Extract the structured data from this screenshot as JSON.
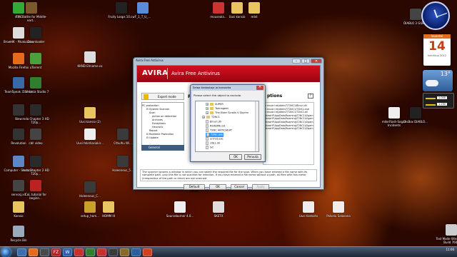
{
  "desktop_icons": [
    {
      "label": "mIRC",
      "color": "#33aa33"
    },
    {
      "label": "The Battle for Middle-eart...",
      "color": "#7a5a2a"
    },
    {
      "label": "Fruity Loops 10.cw",
      "color": "#222"
    },
    {
      "label": "F_1_T_U_...",
      "color": "#5b8bd8"
    },
    {
      "label": "mouseala...",
      "color": "#c33"
    },
    {
      "label": "Uusi kansio",
      "color": "#e8c560"
    },
    {
      "label": "mikt",
      "color": "#e8c560"
    },
    {
      "label": "DIABLO 3 GUEST",
      "color": "#444"
    },
    {
      "label": "BrowHK - Pikakuvake",
      "color": "#ddd"
    },
    {
      "label": "iDownloader",
      "color": "#222"
    },
    {
      "label": "Mozilla Firefox",
      "color": "#e66a1c"
    },
    {
      "label": "uTorrent",
      "color": "#4aa03c"
    },
    {
      "label": "KKND Ehnome.co",
      "color": "#ddd"
    },
    {
      "label": "TeamSpeak 3 Client",
      "color": "#3a69a8"
    },
    {
      "label": "Camtasia Studio 7",
      "color": "#2f7f2f"
    },
    {
      "label": "Biew",
      "color": "#333"
    },
    {
      "label": "mda Chapter 3 HD 720p...",
      "color": "#2a2a2a"
    },
    {
      "label": "Uusi kansio (2)",
      "color": "#e8c560"
    },
    {
      "label": "Revolution",
      "color": "#333"
    },
    {
      "label": "cbll video",
      "color": "#444"
    },
    {
      "label": "Uusi tekstiasiakir...",
      "color": "#eee"
    },
    {
      "label": "Cthulhu Wi...",
      "color": "#3a3a3a"
    },
    {
      "label": "Computer - Shortcut",
      "color": "#5c86c4"
    },
    {
      "label": "mda Chapter 2 HD 720p...",
      "color": "#2a2a2a"
    },
    {
      "label": "Haleeneus_5...",
      "color": "#3a3a3a"
    },
    {
      "label": "servosj.xit",
      "color": "#444"
    },
    {
      "label": "CoL tutorial for beginn...",
      "color": "#b22"
    },
    {
      "label": "Kansio",
      "color": "#e8c560"
    },
    {
      "label": "Haleeneus_C...",
      "color": "#3a3a3a"
    },
    {
      "label": "setup_hom...",
      "color": "#c8a02a"
    },
    {
      "label": "HOMM III",
      "color": "#e8c560"
    },
    {
      "label": "Sourceburner 4.0...",
      "color": "#eee"
    },
    {
      "label": "SKETX",
      "color": "#ddd"
    },
    {
      "label": "Uusi tiedosto",
      "color": "#eee"
    },
    {
      "label": "Palvelu Salasana",
      "color": "#eee"
    },
    {
      "label": "mikeFlash-Sogan Incidents",
      "color": "#eee"
    },
    {
      "label": "DisBox DIABLO...",
      "color": "#222"
    },
    {
      "label": "Recycle Bin",
      "color": "#9ab"
    },
    {
      "label": "Test Mode Windows 7 Build 7601",
      "color": "#ccc"
    }
  ],
  "gadgets": {
    "calendar_weekday": "lauantai",
    "calendar_day": "14",
    "calendar_month": "heinäkuu 2012",
    "weather_temp": "13°",
    "cpu_values": [
      "1.000",
      "1.250"
    ]
  },
  "avira": {
    "window_title": "Avira Free Antivirus",
    "brand": "AVIRA",
    "product": "Avira Free Antivirus",
    "expert_mode": "Expert mode",
    "left_heading": "PC",
    "tree": [
      "PC protection",
      "System Scanner",
      "Scan",
      "Action on detection",
      "Archives",
      "Exceptions",
      "Heuristic",
      "Report",
      "Realtime Protection",
      "Update",
      "General"
    ],
    "right_heading": "ptions",
    "files": [
      "e mustri etyöteksT\\T2NC1\\Binurl.dll",
      "e mustri etyöteksT\\T2NC1\\T2NC1.exe",
      "e mustri etyöteksT\\T2NC1\\T2NC1.dll",
      "BrowHF\\AppData\\Roaming\\T2NC1\\t2gam",
      "BrowHF\\AppData\\Roaming\\T2NC1\\t2gam",
      "BrowHF\\AppData\\Roaming\\T2NC1\\t2gam",
      "BrowHF\\AppData\\Roaming\\T2NC1\\t2gam",
      "BrowHF\\AppData\\Roaming\\T2NC1\\t2gam"
    ],
    "description": "The scanner ignores a window in which you can select the required file for the scan. When you have entered a file name with its complete path, only this file is not scanned for infection. If you have entered a file name without a path, all files with this name (irrespective of the path or drive) are not scanned.",
    "buttons": {
      "default": "Default values",
      "ok": "OK",
      "cancel": "Cancel",
      "apply": "Apply"
    }
  },
  "select_dialog": {
    "title": "Selaa tiedostoja ja kansioita",
    "prompt": "Please select the object to exclude.",
    "items": [
      {
        "label": "SUPER",
        "type": "folder",
        "indent": 2
      },
      {
        "label": "Tarinageet",
        "type": "folder",
        "indent": 2
      },
      {
        "label": "The Elder Scrolls V Skyrim",
        "type": "folder",
        "indent": 2
      },
      {
        "label": "T2NC1",
        "type": "folder",
        "indent": 1
      },
      {
        "label": "Binurl.dll",
        "type": "file",
        "indent": 2
      },
      {
        "label": "README.txt",
        "type": "file",
        "indent": 2
      },
      {
        "label": "T2NC ANTICHEAT",
        "type": "file",
        "indent": 2
      },
      {
        "label": "T2NC.exe",
        "type": "file",
        "indent": 2,
        "selected": true
      },
      {
        "label": "uninst.exe",
        "type": "file",
        "indent": 2
      },
      {
        "label": "zlib1.dll",
        "type": "file",
        "indent": 2
      },
      {
        "label": "txt",
        "type": "file",
        "indent": 2
      }
    ],
    "ok": "OK",
    "cancel": "Peruuta"
  },
  "taskbar": {
    "apps": [
      {
        "label": "",
        "color": "#3a6fb0"
      },
      {
        "label": "",
        "color": "#e66a1c"
      },
      {
        "label": "",
        "color": "#4a4a4a"
      },
      {
        "label": "FZ",
        "color": "#b22222"
      },
      {
        "label": "W",
        "color": "#2b5fb0"
      },
      {
        "label": "",
        "color": "#c83030"
      },
      {
        "label": "",
        "color": "#2f7f2f"
      },
      {
        "label": "",
        "color": "#c83030"
      },
      {
        "label": "",
        "color": "#3a3a3a"
      },
      {
        "label": "",
        "color": "#8a6a2a"
      },
      {
        "label": "",
        "color": "#2a5f9f"
      },
      {
        "label": "",
        "color": "#d04020"
      }
    ],
    "time": "11:06",
    "date": "14.6.2012"
  }
}
